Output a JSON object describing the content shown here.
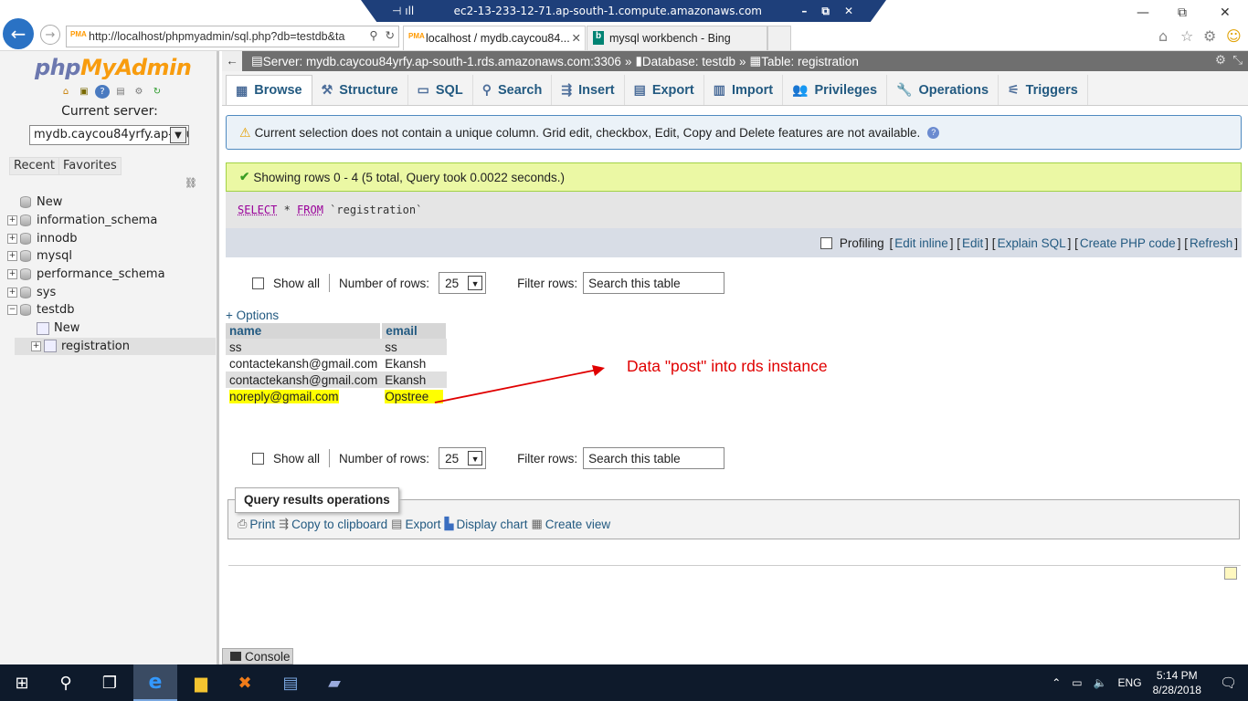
{
  "window": {
    "rdp_title": "ec2-13-233-12-71.ap-south-1.compute.amazonaws.com",
    "address_url": "http://localhost/phpmyadmin/sql.php?db=testdb&ta",
    "tabs": [
      {
        "label": "localhost / mydb.caycou84..."
      },
      {
        "label": "mysql workbench - Bing"
      }
    ]
  },
  "sidebar": {
    "logo_php": "php",
    "logo_myadmin": "MyAdmin",
    "current_server_label": "Current server:",
    "current_server_value": "mydb.caycou84yrfy.ap-sou",
    "tab_recent": "Recent",
    "tab_favorites": "Favorites",
    "tree": [
      {
        "label": "New"
      },
      {
        "label": "information_schema"
      },
      {
        "label": "innodb"
      },
      {
        "label": "mysql"
      },
      {
        "label": "performance_schema"
      },
      {
        "label": "sys"
      },
      {
        "label": "testdb"
      },
      {
        "label": "New"
      },
      {
        "label": "registration"
      }
    ]
  },
  "breadcrumb": {
    "server": "Server: mydb.caycou84yrfy.ap-south-1.rds.amazonaws.com:3306",
    "database": "Database: testdb",
    "table": "Table: registration",
    "sep": "»"
  },
  "tabs": [
    {
      "label": "Browse"
    },
    {
      "label": "Structure"
    },
    {
      "label": "SQL"
    },
    {
      "label": "Search"
    },
    {
      "label": "Insert"
    },
    {
      "label": "Export"
    },
    {
      "label": "Import"
    },
    {
      "label": "Privileges"
    },
    {
      "label": "Operations"
    },
    {
      "label": "Triggers"
    }
  ],
  "notice": "Current selection does not contain a unique column. Grid edit, checkbox, Edit, Copy and Delete features are not available.",
  "success": "Showing rows 0 - 4 (5 total, Query took 0.0022 seconds.)",
  "sql": {
    "select": "SELECT",
    "star": " * ",
    "from": "FROM",
    "table": " `registration`"
  },
  "profiling": {
    "label": "Profiling",
    "edit_inline": "Edit inline",
    "edit": "Edit",
    "explain": "Explain SQL",
    "create_php": "Create PHP code",
    "refresh": "Refresh"
  },
  "nav": {
    "show_all": "Show all",
    "num_rows_label": "Number of rows:",
    "num_rows_value": "25",
    "filter_label": "Filter rows:",
    "filter_placeholder": "Search this table"
  },
  "options_link": "+ Options",
  "table": {
    "headers": [
      "name",
      "email"
    ],
    "rows": [
      [
        "ss",
        "ss"
      ],
      [
        "contactekansh@gmail.com",
        "Ekansh"
      ],
      [
        "contactekansh@gmail.com",
        "Ekansh"
      ],
      [
        "noreply@gmail.com",
        "Opstree"
      ]
    ]
  },
  "annotation": "Data \"post\" into rds instance",
  "query_results_ops": {
    "title": "Query results operations",
    "print": "Print",
    "copy": "Copy to clipboard",
    "export": "Export",
    "chart": "Display chart",
    "view": "Create view"
  },
  "console": "Console",
  "taskbar": {
    "lang": "ENG",
    "time": "5:14 PM",
    "date": "8/28/2018"
  },
  "colors": {
    "link": "#235a81",
    "annotation": "#e00000",
    "highlight": "#ffff00",
    "success_bg": "#ebf8a4"
  }
}
